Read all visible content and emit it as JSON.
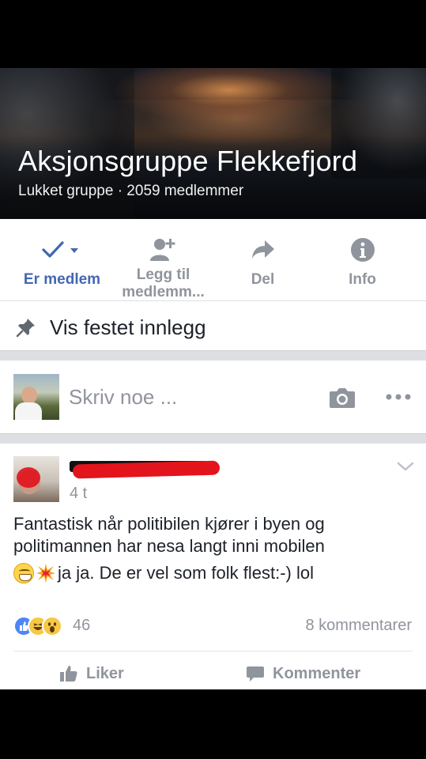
{
  "group": {
    "title": "Aksjonsgruppe Flekkefjord",
    "subtitle": "Lukket gruppe · 2059 medlemmer"
  },
  "actions": [
    {
      "label": "Er medlem",
      "icon": "check-dropdown-icon",
      "active": true
    },
    {
      "label": "Legg til medlemm...",
      "icon": "add-member-icon",
      "active": false
    },
    {
      "label": "Del",
      "icon": "share-arrow-icon",
      "active": false
    },
    {
      "label": "Info",
      "icon": "info-icon",
      "active": false
    }
  ],
  "pinned": {
    "label": "Vis festet innlegg",
    "icon": "pin-icon"
  },
  "composer": {
    "placeholder": "Skriv noe ...",
    "icons": [
      "camera-icon",
      "more-dots-icon"
    ]
  },
  "post": {
    "time": "4 t",
    "text_line1": "Fantastisk når politibilen kjører i byen og",
    "text_line2": "politimannen har nesa langt inni mobilen",
    "text_line3": "ja ja. De er vel som folk flest:-) lol",
    "emojis": [
      "grinning-face",
      "collision"
    ],
    "reactions": [
      "like",
      "haha",
      "wow"
    ],
    "reaction_count": "46",
    "comment_count": "8 kommentarer",
    "like_label": "Liker",
    "comment_label": "Kommenter"
  },
  "colors": {
    "accent": "#4267b2",
    "muted": "#90949c",
    "separator": "#dddfe2"
  }
}
